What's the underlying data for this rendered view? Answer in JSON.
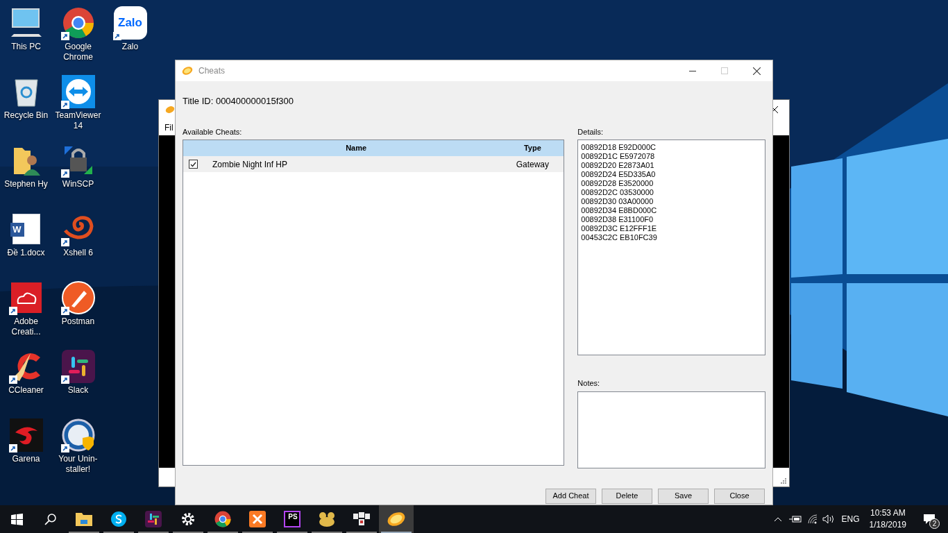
{
  "desktop_icons": [
    {
      "label": "This PC",
      "kind": "computer",
      "shortcut": false
    },
    {
      "label": "Recycle Bin",
      "kind": "bin",
      "shortcut": false
    },
    {
      "label": "Stephen Hy",
      "kind": "userfolder",
      "shortcut": false
    },
    {
      "label": "Đề 1.docx",
      "kind": "word",
      "shortcut": false,
      "logo_text": "W"
    },
    {
      "label": "Adobe Creati...",
      "kind": "adobe",
      "shortcut": true
    },
    {
      "label": "CCleaner",
      "kind": "ccleaner",
      "shortcut": true
    },
    {
      "label": "Garena",
      "kind": "garena",
      "shortcut": true
    },
    {
      "label": "Google Chrome",
      "kind": "chrome",
      "shortcut": true
    },
    {
      "label": "TeamViewer 14",
      "kind": "teamviewer",
      "shortcut": true
    },
    {
      "label": "WinSCP",
      "kind": "lock",
      "shortcut": true
    },
    {
      "label": "Xshell 6",
      "kind": "shell",
      "shortcut": true
    },
    {
      "label": "Postman",
      "kind": "postman",
      "shortcut": true
    },
    {
      "label": "Slack",
      "kind": "slack",
      "shortcut": true
    },
    {
      "label": "Your Unin-staller!",
      "kind": "uninstaller",
      "shortcut": true
    },
    {
      "label": "Zalo",
      "kind": "zalo",
      "shortcut": true,
      "logo_text": "Zalo"
    }
  ],
  "background_window": {
    "menu": "Fil"
  },
  "dialog": {
    "title": "Cheats",
    "title_id": "Title ID: 000400000015f300",
    "available_label": "Available Cheats:",
    "table": {
      "columns": [
        "Name",
        "Type"
      ],
      "rows": [
        {
          "name": "Zombie Night Inf HP",
          "type": "Gateway",
          "checked": true
        }
      ]
    },
    "details_label": "Details:",
    "details": [
      "00892D18 E92D000C",
      "00892D1C E5972078",
      "00892D20 E2873A01",
      "00892D24 E5D335A0",
      "00892D28 E3520000",
      "00892D2C 03530000",
      "00892D30 03A00000",
      "00892D34 E8BD000C",
      "00892D38 E31100F0",
      "00892D3C E12FFF1E",
      "00453C2C EB10FC39"
    ],
    "notes_label": "Notes:",
    "buttons": [
      "Add Cheat",
      "Delete",
      "Save",
      "Close"
    ]
  },
  "taskbar": {
    "apps": [
      {
        "kind": "explorer",
        "running": true,
        "selected": false
      },
      {
        "kind": "skype",
        "running": true,
        "selected": false
      },
      {
        "kind": "slack",
        "running": true,
        "selected": false
      },
      {
        "kind": "settings",
        "running": true,
        "selected": false
      },
      {
        "kind": "chrome",
        "running": true,
        "selected": false
      },
      {
        "kind": "xampp",
        "running": true,
        "selected": false
      },
      {
        "kind": "phpstorm",
        "running": true,
        "selected": false,
        "logo_text": "PS"
      },
      {
        "kind": "paw",
        "running": true,
        "selected": false
      },
      {
        "kind": "keys",
        "running": true,
        "selected": false
      },
      {
        "kind": "citra",
        "running": true,
        "selected": true
      }
    ],
    "language": "ENG",
    "time": "10:53 AM",
    "date": "1/18/2019",
    "notification_count": "2"
  }
}
